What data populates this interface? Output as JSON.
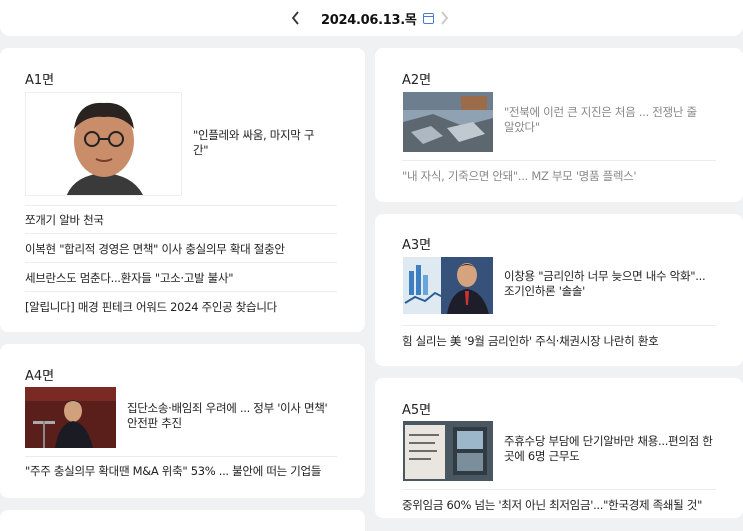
{
  "header": {
    "date": "2024.06.13.목",
    "prev_icon": "chevron-left-icon",
    "next_icon": "chevron-right-icon",
    "calendar_icon": "calendar-icon"
  },
  "sections": {
    "a1": {
      "title": "A1면",
      "lead": "\"인플레와 싸움, 마지막 구간\"",
      "headlines": [
        "쪼개기 알바 천국",
        "이복현 \"합리적 경영은 면책\" 이사 충실의무 확대 절충안",
        "세브란스도 멈춘다...환자들 \"고소·고발 불사\"",
        "[알립니다] 매경 핀테크 어워드 2024 주인공 찾습니다"
      ]
    },
    "a2": {
      "title": "A2면",
      "lead": "\"전북에 이런 큰 지진은 처음 ... 전쟁난 줄 알았다\"",
      "headlines": [
        "\"내 자식, 기죽으면 안돼\"... MZ 부모 '명품 플렉스'"
      ]
    },
    "a3": {
      "title": "A3면",
      "lead": "이창용 \"금리인하 너무 늦으면 내수 악화\"... 조기인하론 '솔솔'",
      "headlines": [
        "힘 실리는 美 '9월 금리인하' 주식·채권시장 나란히 환호"
      ]
    },
    "a4": {
      "title": "A4면",
      "lead": "집단소송·배임죄 우려에 ... 정부 '이사 면책' 안전판 추진",
      "headlines": [
        "\"주주 충실의무 확대땐 M&A 위축\" 53% ... 불안에 떠는 기업들"
      ]
    },
    "a5": {
      "title": "A5면",
      "lead": "주휴수당 부담에 단기알바만 채용...편의점 한 곳에 6명 근무도",
      "headlines": [
        "중위임금 60% 넘는 '최저 아닌 최저임금'...\"한국경제 족쇄될 것\""
      ]
    }
  }
}
